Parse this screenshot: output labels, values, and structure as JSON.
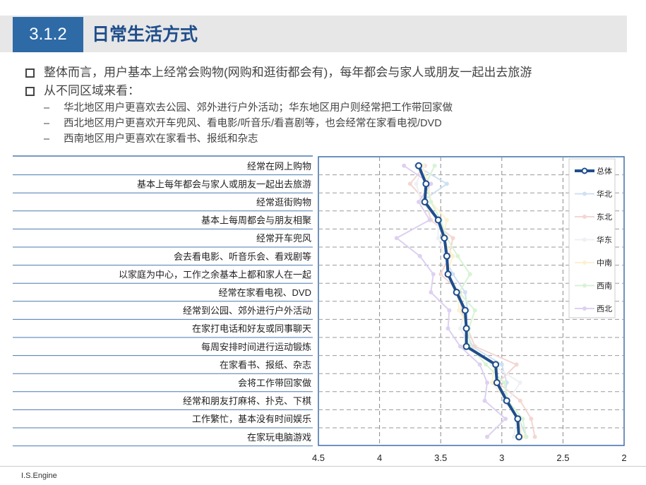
{
  "header": {
    "section_number": "3.1.2",
    "title": "日常生活方式"
  },
  "bullets": [
    {
      "text": "整体而言，用户基本上经常会购物(网购和逛街都会有)，每年都会与家人或朋友一起出去旅游"
    },
    {
      "text": "从不同区域来看："
    }
  ],
  "sub_bullets": [
    {
      "dash": "–",
      "text": "华北地区用户更喜欢去公园、郊外进行户外活动；华东地区用户则经常把工作带回家做"
    },
    {
      "dash": "–",
      "text": "西北地区用户更喜欢开车兜风、看电影/听音乐/看喜剧等，也会经常在家看电视/DVD"
    },
    {
      "dash": "–",
      "text": "西南地区用户更喜欢在家看书、报纸和杂志"
    }
  ],
  "footer": {
    "brand": "I.S.Engine"
  },
  "chart_data": {
    "type": "line",
    "orientation": "vertical-categories",
    "categories": [
      "经常在网上购物",
      "基本上每年都会与家人或朋友一起出去旅游",
      "经常逛街购物",
      "基本上每周都会与朋友相聚",
      "经常开车兜风",
      "会去看电影、听音乐会、看戏剧等",
      "以家庭为中心，工作之余基本上都和家人在一起",
      "经常在家看电视、DVD",
      "经常到公园、郊外进行户外活动",
      "在家打电话和好友或同事聊天",
      "每周安排时间进行运动锻炼",
      "在家看书、报纸、杂志",
      "会将工作带回家做",
      "经常和朋友打麻将、扑克、下棋",
      "工作繁忙，基本没有时间娱乐",
      "在家玩电脑游戏"
    ],
    "xlim": [
      4.5,
      2
    ],
    "x_ticks": [
      "4.5",
      "4",
      "3.5",
      "3",
      "2.5",
      "2"
    ],
    "grid": true,
    "legend_position": "right",
    "series": [
      {
        "name": "总体",
        "color": "#1f4e8c",
        "emphasis": true,
        "values": [
          3.68,
          3.62,
          3.63,
          3.52,
          3.47,
          3.45,
          3.44,
          3.37,
          3.3,
          3.29,
          3.29,
          3.05,
          3.04,
          2.96,
          2.87,
          2.86
        ]
      },
      {
        "name": "华北",
        "color": "#cfe0f3",
        "values": [
          3.7,
          3.45,
          3.66,
          3.5,
          3.46,
          3.47,
          3.4,
          3.3,
          3.28,
          3.3,
          3.24,
          3.0,
          2.96,
          2.98,
          2.86,
          2.8
        ]
      },
      {
        "name": "东北",
        "color": "#f3d7d3",
        "values": [
          3.63,
          3.75,
          3.62,
          3.58,
          3.4,
          3.43,
          3.5,
          3.34,
          3.33,
          3.28,
          3.22,
          2.88,
          3.03,
          2.85,
          2.76,
          2.73
        ]
      },
      {
        "name": "华东",
        "color": "#eef0f4",
        "values": [
          3.64,
          3.7,
          3.66,
          3.52,
          3.52,
          3.47,
          3.43,
          3.38,
          3.3,
          3.34,
          3.26,
          3.08,
          2.85,
          2.95,
          2.88,
          2.9
        ]
      },
      {
        "name": "中南",
        "color": "#fdf1cf",
        "values": [
          3.65,
          3.6,
          3.58,
          3.45,
          3.48,
          3.4,
          3.45,
          3.36,
          3.35,
          3.27,
          3.31,
          3.06,
          3.08,
          2.96,
          2.86,
          2.83
        ]
      },
      {
        "name": "西南",
        "color": "#d8f3d4",
        "values": [
          3.55,
          3.62,
          3.58,
          3.5,
          3.45,
          3.36,
          3.26,
          3.35,
          3.22,
          3.27,
          3.26,
          3.13,
          2.98,
          2.95,
          2.83,
          2.8
        ]
      },
      {
        "name": "西北",
        "color": "#ddd1f0",
        "values": [
          3.8,
          3.58,
          3.68,
          3.59,
          3.86,
          3.67,
          3.56,
          3.58,
          3.43,
          3.44,
          3.34,
          3.18,
          3.12,
          3.14,
          2.97,
          3.12
        ]
      }
    ]
  }
}
